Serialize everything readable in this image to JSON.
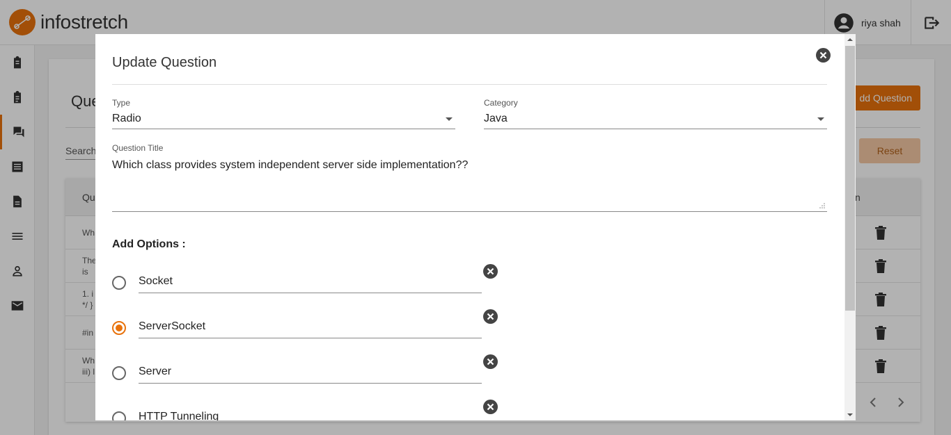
{
  "app": {
    "brand": "infostretch",
    "user_name": "riya shah"
  },
  "colors": {
    "accent": "#e8720c",
    "overlay": "rgba(0,0,0,0.3)"
  },
  "sidebar": {
    "items": [
      {
        "icon": "clipboard-icon"
      },
      {
        "icon": "clipboard-list-icon"
      },
      {
        "icon": "forum-icon",
        "active": true
      },
      {
        "icon": "list-alt-icon"
      },
      {
        "icon": "document-icon"
      },
      {
        "icon": "menu-icon"
      },
      {
        "icon": "person-icon"
      },
      {
        "icon": "mail-icon"
      }
    ]
  },
  "page": {
    "title_partial": "Que",
    "add_button": "dd Question",
    "search_label": "Search",
    "reset_button": "Reset",
    "table": {
      "head_left": "Qu",
      "head_right": "n",
      "rows": [
        {
          "text": "Wh"
        },
        {
          "text": "The\nis"
        },
        {
          "text": "1. i\n*/ }"
        },
        {
          "text": "#in"
        },
        {
          "text": "Wh\niii) l"
        }
      ]
    }
  },
  "modal": {
    "title": "Update Question",
    "type": {
      "label": "Type",
      "value": "Radio"
    },
    "category": {
      "label": "Category",
      "value": "Java"
    },
    "question_title": {
      "label": "Question Title",
      "value": "Which class provides system independent server side implementation??"
    },
    "options_heading": "Add Options :",
    "options": [
      {
        "text": "Socket",
        "selected": false
      },
      {
        "text": "ServerSocket",
        "selected": true
      },
      {
        "text": "Server",
        "selected": false
      },
      {
        "text": "HTTP Tunneling",
        "selected": false
      }
    ]
  }
}
